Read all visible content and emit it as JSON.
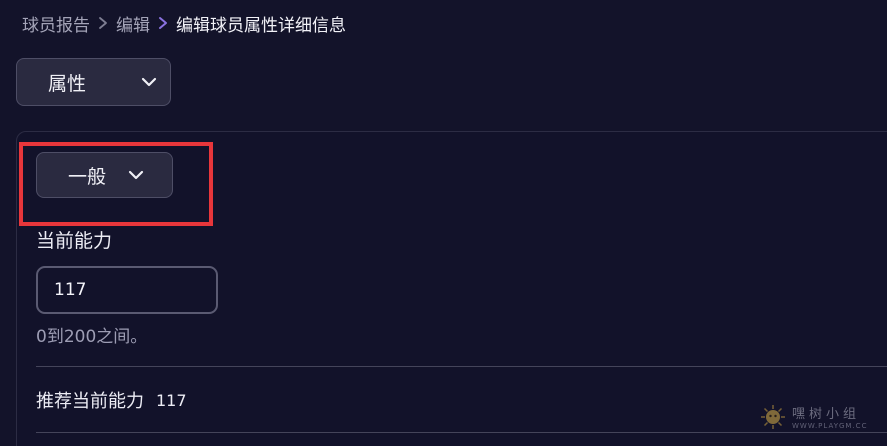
{
  "breadcrumb": {
    "items": [
      "球员报告",
      "编辑",
      "编辑球员属性详细信息"
    ]
  },
  "category_dropdown": {
    "label": "属性",
    "icon": "chevron-down-icon"
  },
  "subcategory_dropdown": {
    "label": "一般",
    "icon": "chevron-down-icon"
  },
  "current_ability": {
    "label": "当前能力",
    "value": "117",
    "helper": "0到200之间。"
  },
  "recommended": {
    "label": "推荐当前能力",
    "value": "117"
  },
  "watermark": {
    "text": "嘿树小组",
    "url": "WWW.PLAYGM.CC"
  },
  "colors": {
    "background": "#13132a",
    "dropdown_bg": "#2a2a40",
    "highlight": "#e8363b",
    "current_crumb_separator": "#8a72e0"
  }
}
